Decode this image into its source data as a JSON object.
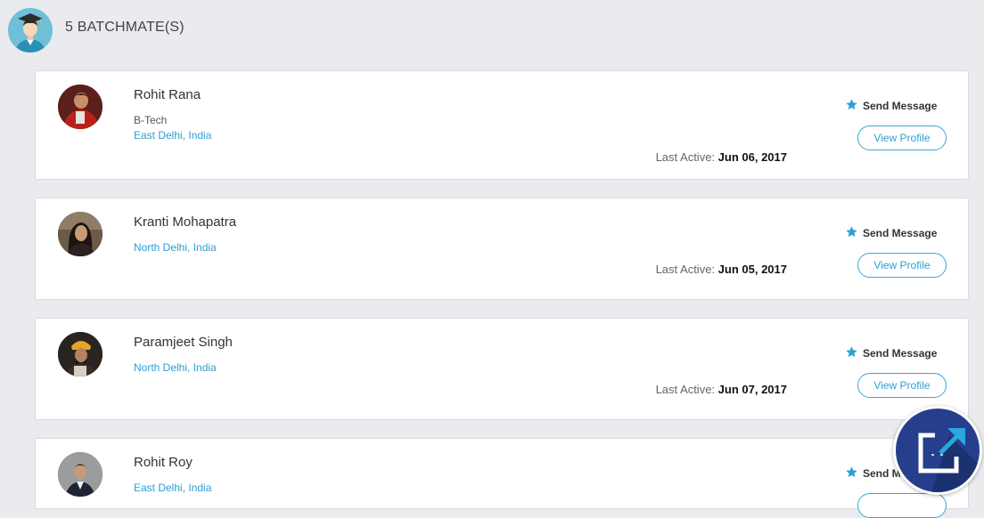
{
  "header": {
    "title": "5 BATCHMATE(S)"
  },
  "batchmates": [
    {
      "name": "Rohit Rana",
      "degree": "B-Tech",
      "location": "East Delhi, India",
      "last_active_label": "Last Active:",
      "last_active_date": "Jun 06, 2017",
      "send_message_label": "Send Message",
      "view_profile_label": "View Profile"
    },
    {
      "name": "Kranti Mohapatra",
      "degree": "",
      "location": "North Delhi, India",
      "last_active_label": "Last Active:",
      "last_active_date": "Jun 05, 2017",
      "send_message_label": "Send Message",
      "view_profile_label": "View Profile"
    },
    {
      "name": "Paramjeet Singh",
      "degree": "",
      "location": "North Delhi, India",
      "last_active_label": "Last Active:",
      "last_active_date": "Jun 07, 2017",
      "send_message_label": "Send Message",
      "view_profile_label": "View Profile"
    },
    {
      "name": "Rohit Roy",
      "degree": "",
      "location": "East Delhi, India",
      "send_message_label": "Send M"
    }
  ],
  "icons": {
    "header_avatar": "graduate-avatar-icon",
    "message": "star-icon",
    "fab": "external-link-icon"
  },
  "colors": {
    "accent": "#2d9fd3",
    "background": "#e9ebee",
    "fab": "#253f8c"
  }
}
